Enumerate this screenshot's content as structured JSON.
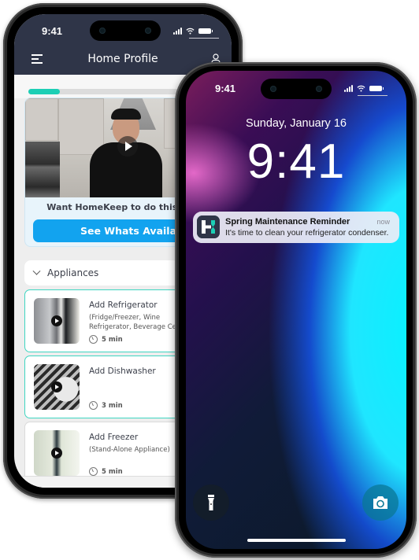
{
  "back_phone": {
    "status_bar": {
      "time": "9:41",
      "icons": [
        "cellular-signal-icon",
        "wifi-icon",
        "battery-icon"
      ]
    },
    "header": {
      "title": "Home Profile",
      "menu_icon": "hamburger-menu-icon",
      "profile_icon": "user-icon"
    },
    "onboarding_progress": {
      "fraction": 0.16,
      "color": "#1ccfb5"
    },
    "video_card": {
      "play_icon": "play-icon",
      "prompt": "Want HomeKeep to do this for you?",
      "cta_label": "See Whats Available",
      "cta_color": "#12a3ef"
    },
    "section": {
      "label": "Appliances",
      "expanded": true
    },
    "items": [
      {
        "title": "Add Refrigerator",
        "subtitle_lines": [
          "(Fridge/Freezer, Wine",
          "Refrigerator, Beverage Center)"
        ],
        "duration": "5 min",
        "highlighted": true
      },
      {
        "title": "Add Dishwasher",
        "subtitle_lines": [],
        "duration": "3 min",
        "highlighted": true
      },
      {
        "title": "Add Freezer",
        "subtitle_lines": [
          "(Stand-Alone Appliance)"
        ],
        "duration": "5 min",
        "highlighted": false
      }
    ]
  },
  "front_phone": {
    "status_bar": {
      "time": "9:41",
      "icons": [
        "cellular-signal-icon",
        "wifi-icon",
        "battery-icon"
      ]
    },
    "lock_screen": {
      "date": "Sunday, January 16",
      "time": "9:41",
      "notification": {
        "app_icon": "homekeep-app-icon",
        "title": "Spring Maintenance Reminder",
        "body": "It's time to clean your refrigerator condenser.",
        "time": "now"
      },
      "flashlight_icon": "flashlight-icon",
      "camera_icon": "camera-icon"
    }
  }
}
